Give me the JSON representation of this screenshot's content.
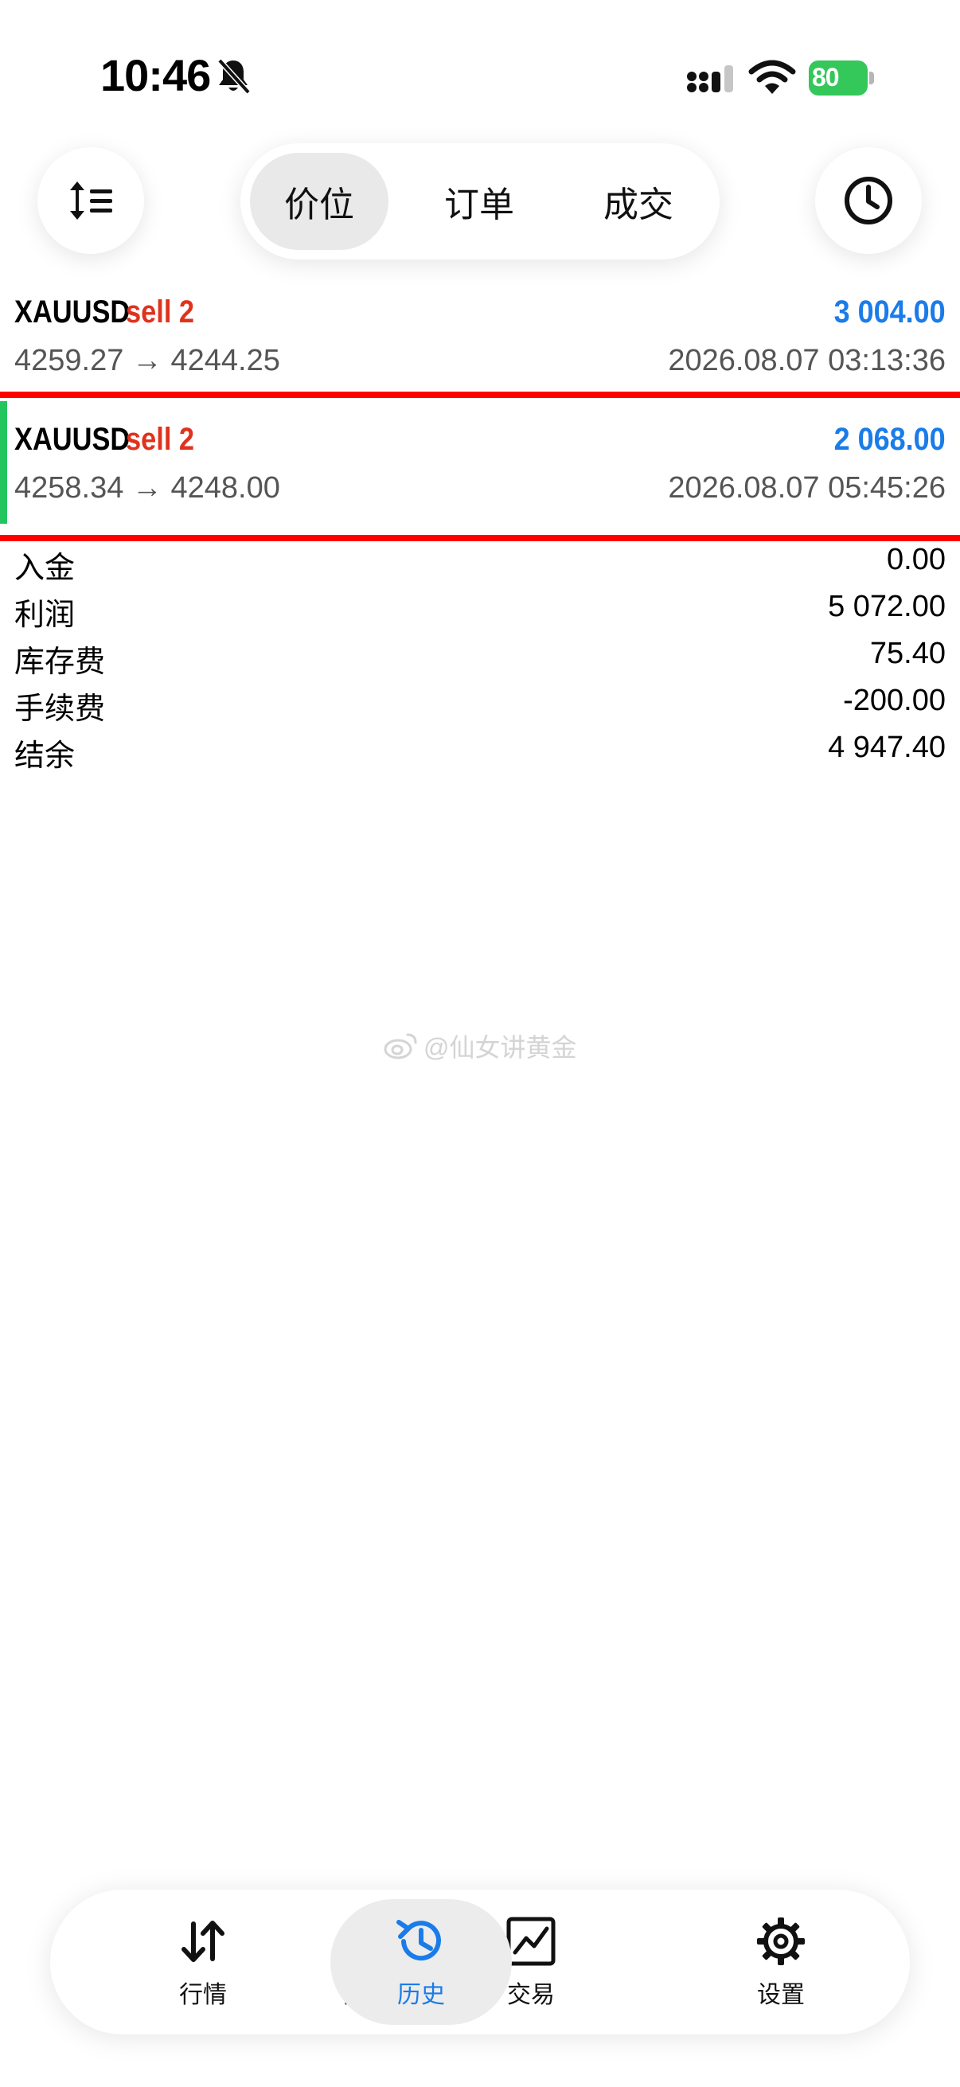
{
  "status_bar": {
    "time": "10:46",
    "battery": "80",
    "icons": [
      "bell-slash-icon",
      "signal-icon",
      "wifi-icon",
      "battery-charging-icon"
    ]
  },
  "toolbar": {
    "left_icon": "sort-icon",
    "right_icon": "clock-icon",
    "tabs": [
      {
        "label": "价位",
        "active": true
      },
      {
        "label": "订单",
        "active": false
      },
      {
        "label": "成交",
        "active": false
      }
    ]
  },
  "deals": [
    {
      "symbol": "XAUUSD",
      "direction": "sell 2",
      "profit": "3 004.00",
      "prices": "4259.27 → 4244.25",
      "datetime": "2026.08.07 03:13:36"
    },
    {
      "symbol": "XAUUSD",
      "direction": "sell 2",
      "profit": "2 068.00",
      "prices": "4258.34 → 4248.00",
      "datetime": "2026.08.07 05:45:26"
    }
  ],
  "summary": [
    {
      "label": "入金",
      "value": "0.00"
    },
    {
      "label": "利润",
      "value": "5 072.00"
    },
    {
      "label": "库存费",
      "value": "75.40"
    },
    {
      "label": "手续费",
      "value": "-200.00"
    },
    {
      "label": "结余",
      "value": "4 947.40"
    }
  ],
  "watermark": "@仙女讲黄金",
  "bottom_nav": [
    {
      "label": "行情",
      "icon": "arrows-up-down-icon",
      "active": false
    },
    {
      "label": "图表",
      "icon": "candlestick-icon",
      "active": false
    },
    {
      "label": "交易",
      "icon": "trade-chart-icon",
      "active": false
    },
    {
      "label": "历史",
      "icon": "history-icon",
      "active": true
    },
    {
      "label": "设置",
      "icon": "gear-icon",
      "active": false
    }
  ],
  "colors": {
    "profit": "#1a7ce8",
    "sell": "#e0321c",
    "highlight_line": "#ff0000",
    "accent_bar": "#22c55e",
    "battery": "#34c759"
  }
}
